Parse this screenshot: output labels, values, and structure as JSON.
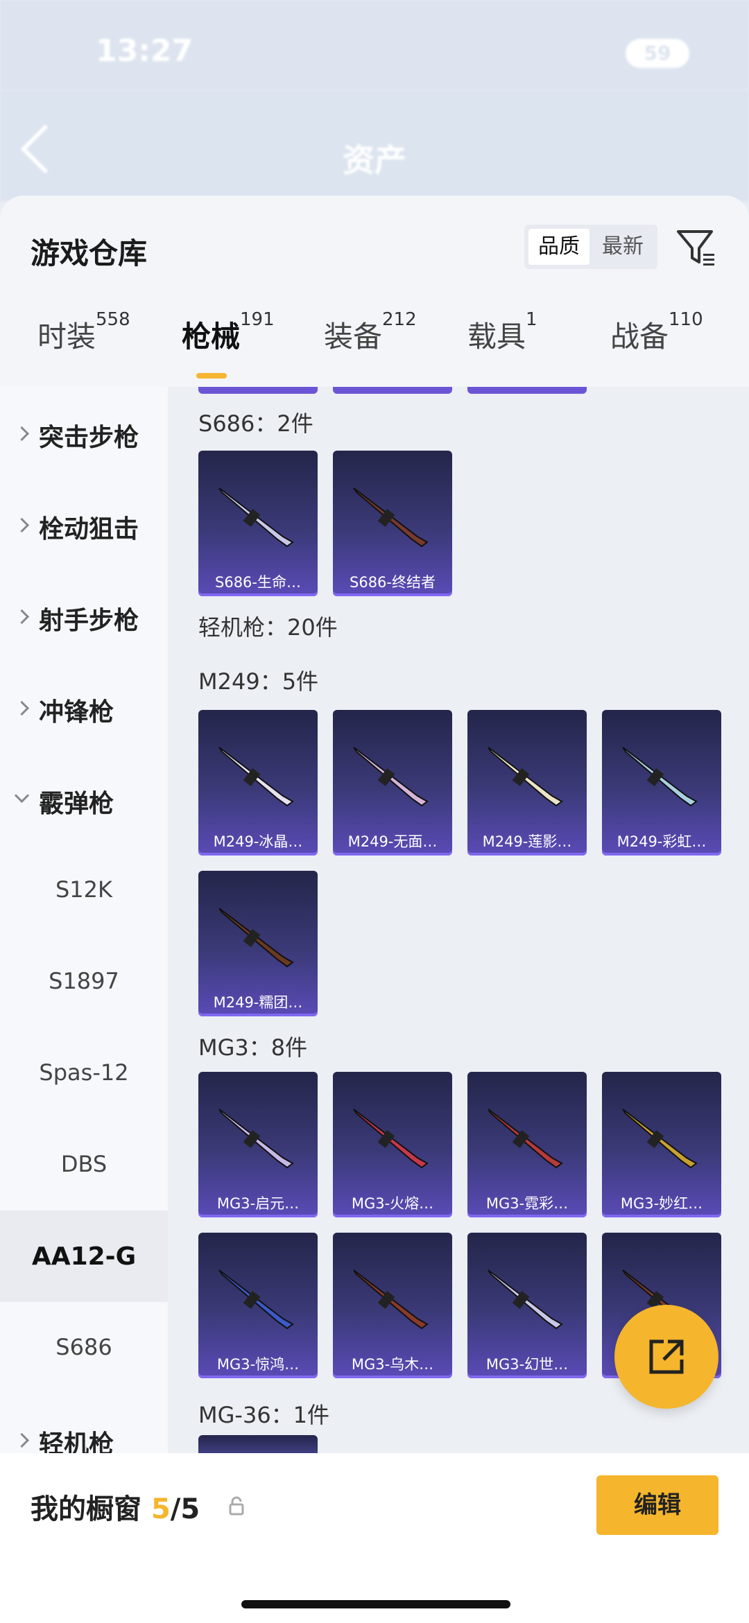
{
  "status_bar": {
    "time": "13:27",
    "battery": "59"
  },
  "top_nav": {
    "title": "资产"
  },
  "sheet": {
    "title": "游戏仓库",
    "sort_options": [
      "品质",
      "最新"
    ],
    "tabs": [
      {
        "label": "时装",
        "count": "558"
      },
      {
        "label": "枪械",
        "count": "191"
      },
      {
        "label": "装备",
        "count": "212"
      },
      {
        "label": "载具",
        "count": "1"
      },
      {
        "label": "战备",
        "count": "110"
      }
    ]
  },
  "sidebar": {
    "items": [
      {
        "label": "突击步枪",
        "kind": "category"
      },
      {
        "label": "栓动狙击",
        "kind": "category"
      },
      {
        "label": "射手步枪",
        "kind": "category"
      },
      {
        "label": "冲锋枪",
        "kind": "category"
      },
      {
        "label": "霰弹枪",
        "kind": "category-open"
      },
      {
        "label": "S12K",
        "kind": "sub"
      },
      {
        "label": "S1897",
        "kind": "sub"
      },
      {
        "label": "Spas-12",
        "kind": "sub"
      },
      {
        "label": "DBS",
        "kind": "sub"
      },
      {
        "label": "AA12-G",
        "kind": "sub-selected"
      },
      {
        "label": "S686",
        "kind": "sub"
      },
      {
        "label": "轻机枪",
        "kind": "category"
      }
    ]
  },
  "content": {
    "s686_header": "S686：2件",
    "s686_items": [
      "S686-生命…",
      "S686-终结者"
    ],
    "lmg_header": "轻机枪：20件",
    "m249_header": "M249：5件",
    "m249_items": [
      "M249-冰晶…",
      "M249-无面…",
      "M249-莲影…",
      "M249-彩虹…",
      "M249-糯团…"
    ],
    "mg3_header": "MG3：8件",
    "mg3_items": [
      "MG3-启元…",
      "MG3-火熔…",
      "MG3-霓彩…",
      "MG3-妙红…",
      "MG3-惊鸿…",
      "MG3-乌木…",
      "MG3-幻世…",
      ""
    ],
    "mg36_header": "MG-36：1件"
  },
  "bottom_bar": {
    "label": "我的橱窗",
    "count_current": "5",
    "count_sep": "/5",
    "edit_label": "编辑"
  },
  "colors": {
    "accent": "#f5b52c",
    "card_top": "#24254a",
    "card_bottom": "#5a4bb7"
  },
  "icons": [
    "back-arrow-icon",
    "filter-icon",
    "chevron-right-icon",
    "chevron-down-icon",
    "share-icon",
    "lock-icon"
  ]
}
